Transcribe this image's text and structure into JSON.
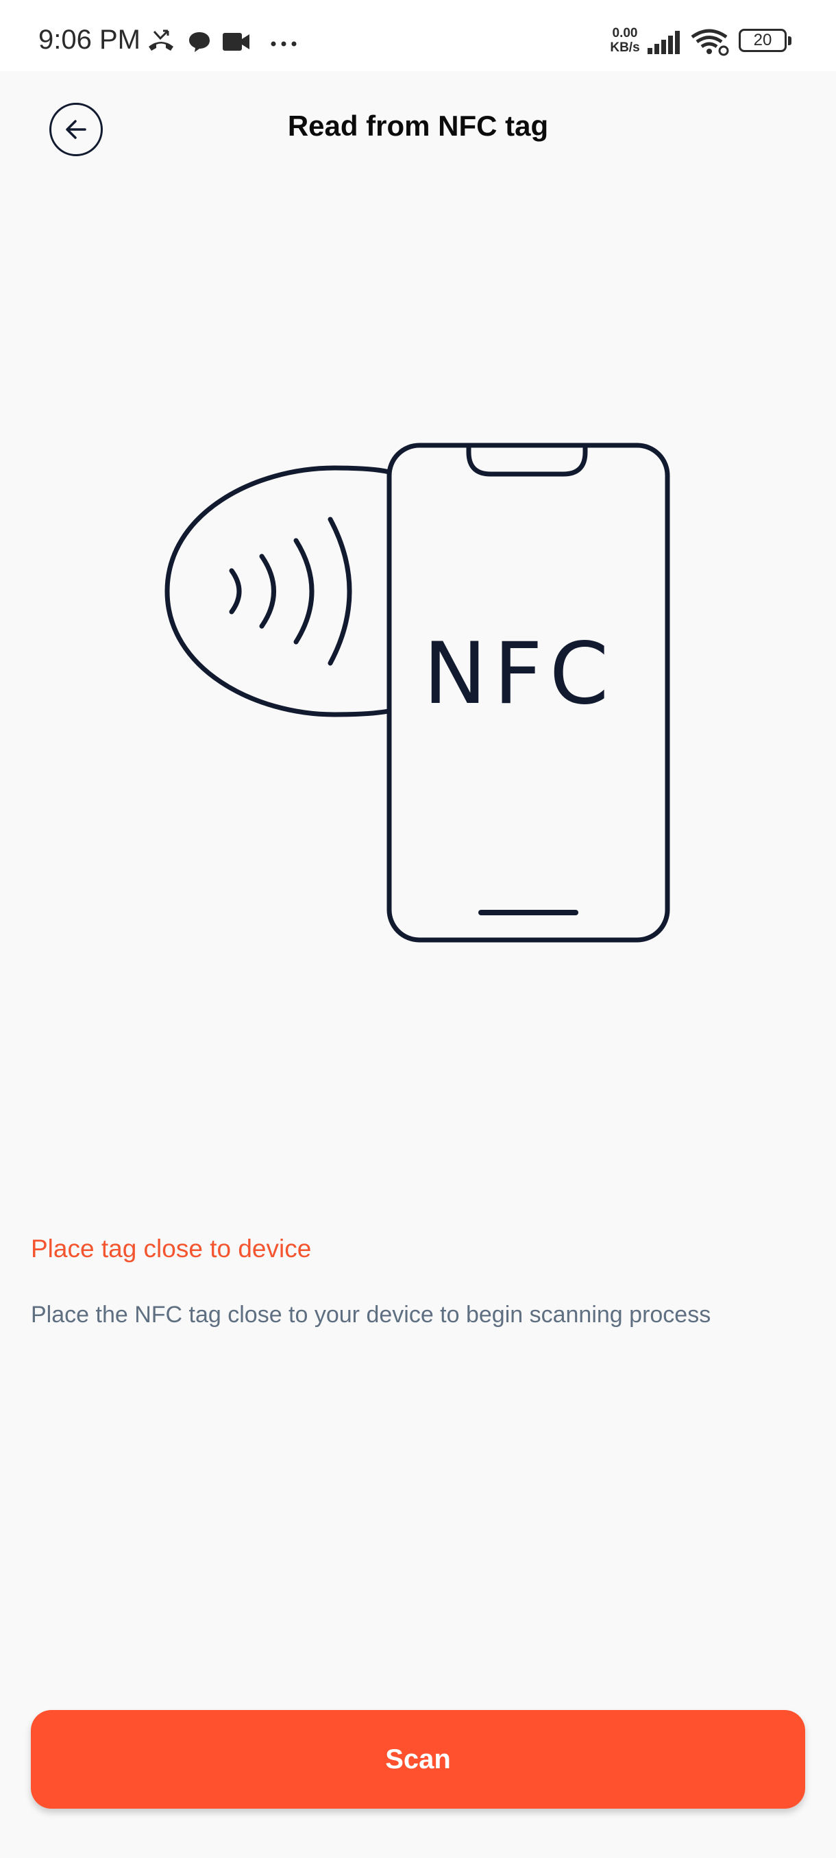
{
  "status_bar": {
    "time": "9:06 PM",
    "network_speed_value": "0.00",
    "network_speed_unit": "KB/s",
    "battery_level": "20",
    "icons": [
      "missed-call-icon",
      "chat-bubble-icon",
      "video-camera-icon",
      "more-dots-icon",
      "signal-bars-icon",
      "wifi-icon",
      "battery-icon"
    ]
  },
  "header": {
    "back_icon": "back-arrow-icon",
    "title": "Read from NFC tag"
  },
  "illustration": {
    "phone_label": "NFC",
    "icons": [
      "nfc-tag-icon",
      "nfc-waves-icon",
      "phone-icon"
    ]
  },
  "instruction": {
    "title": "Place tag close to device",
    "description": "Place the NFC tag close to your device to begin scanning process"
  },
  "actions": {
    "scan_label": "Scan"
  },
  "colors": {
    "accent": "#ff512d",
    "instruction_title": "#f4552f",
    "description": "#5f6f82",
    "ink": "#121a2f",
    "background": "#f9f9f9"
  }
}
